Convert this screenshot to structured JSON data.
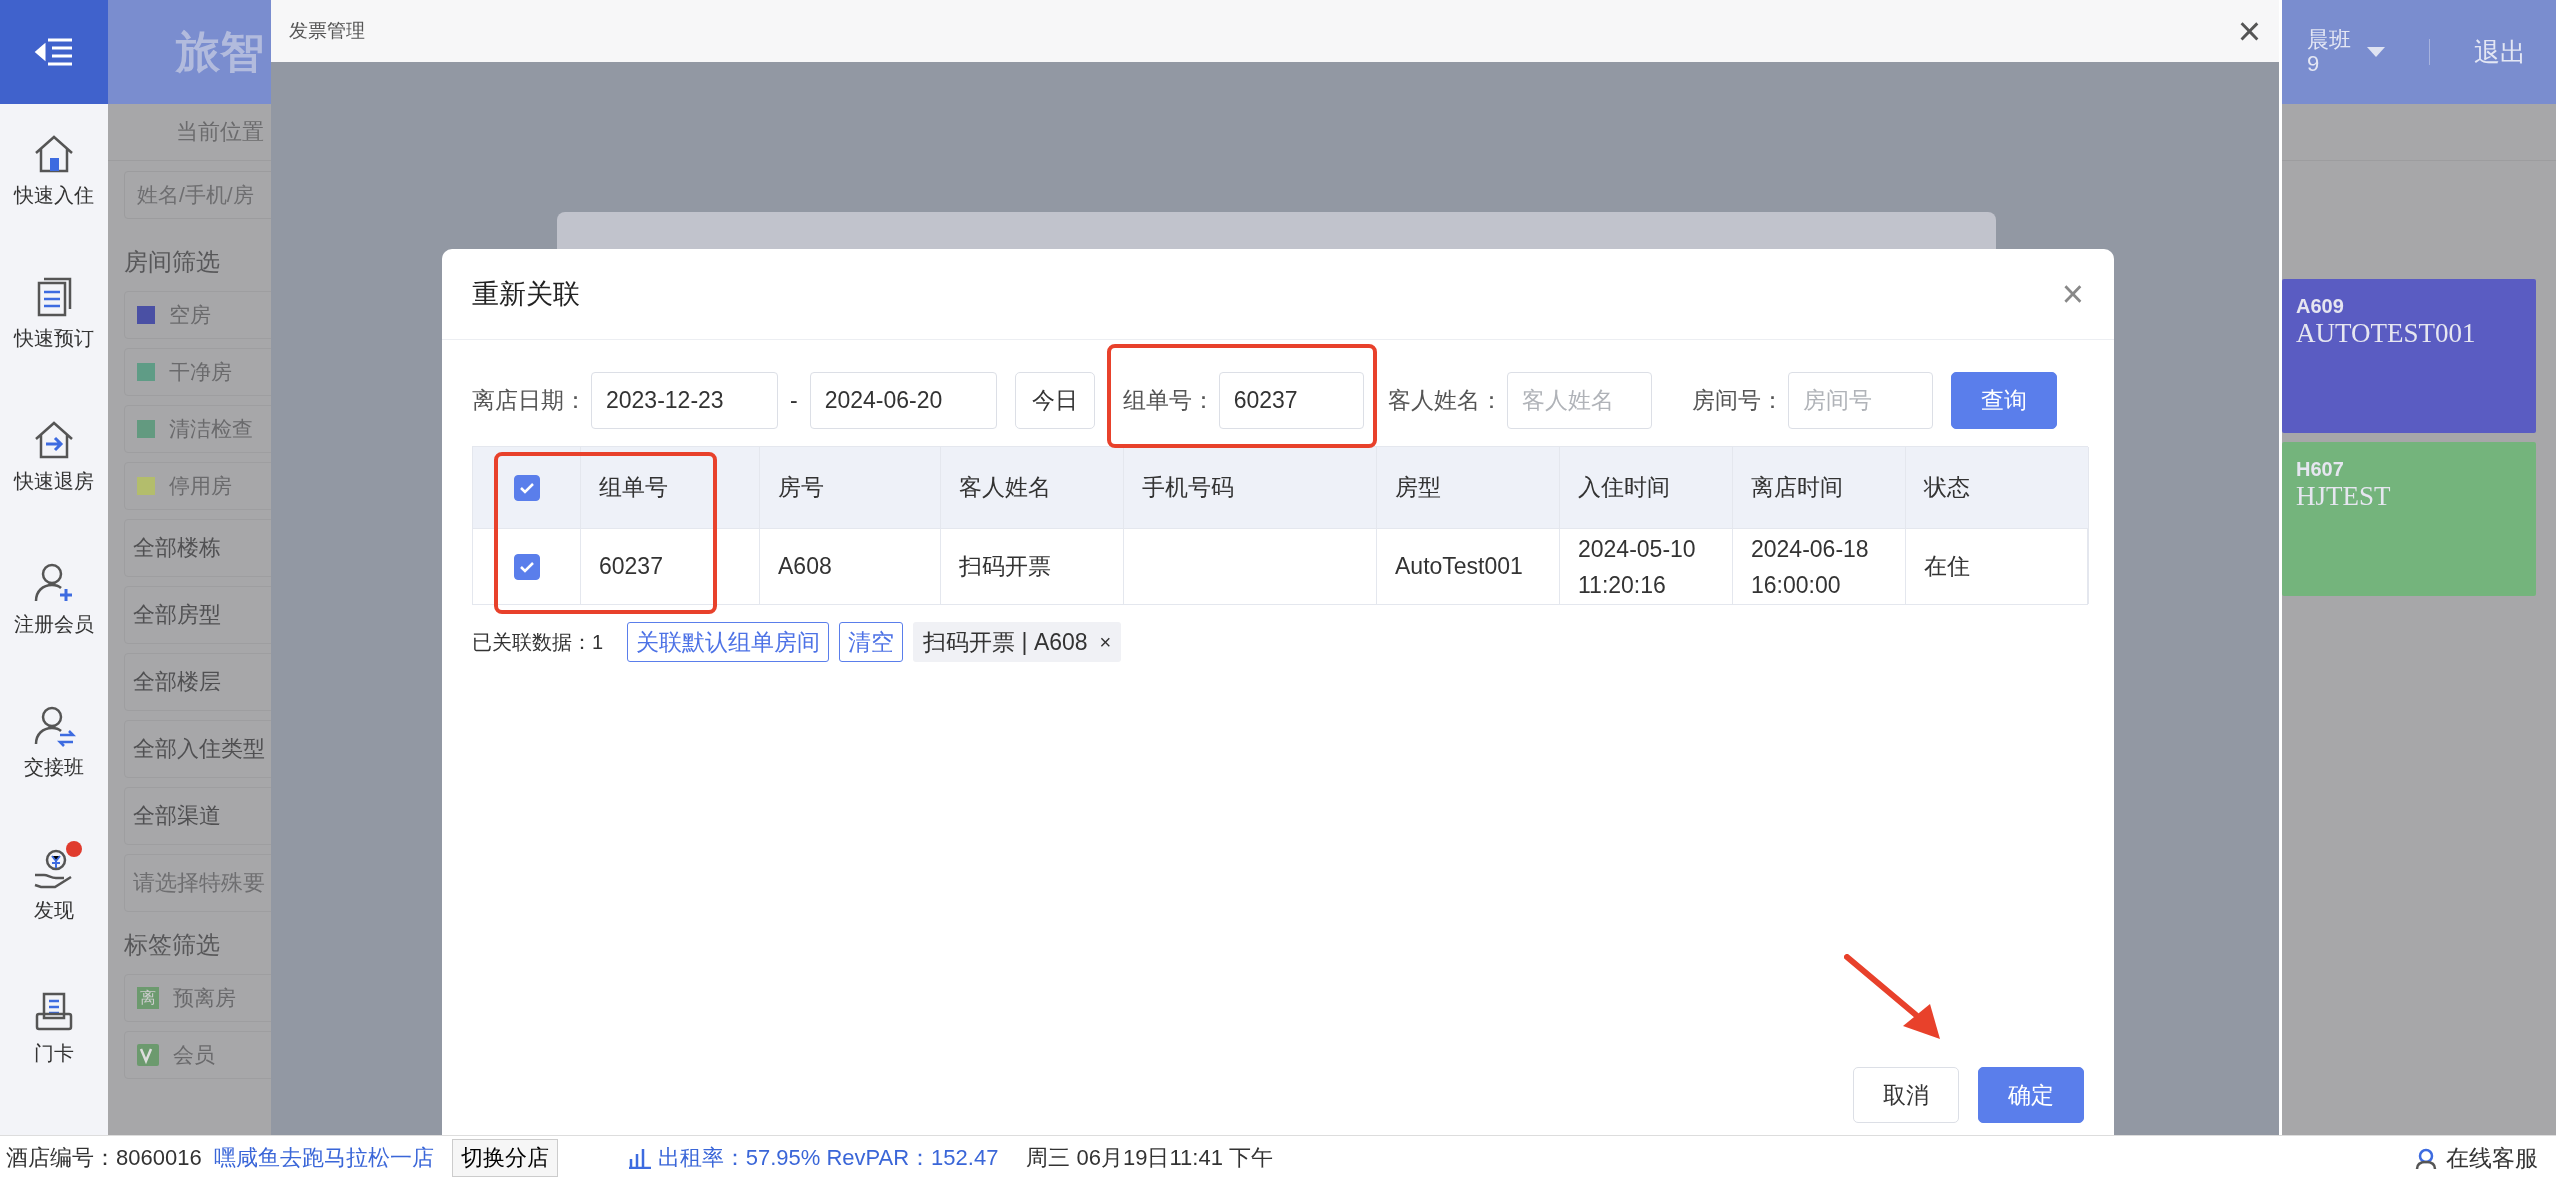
{
  "app": {
    "logo": "旅智",
    "shift": "晨班",
    "shift_sub": "9",
    "logout": "退出",
    "breadcrumb": "当前位置",
    "search_placeholder": "姓名/手机/房",
    "room_filter_title": "房间筛选",
    "room_filters": [
      {
        "label": "空房",
        "color": "#4a50a4"
      },
      {
        "label": "干净房",
        "color": "#5f9c86"
      },
      {
        "label": "清洁检查",
        "color": "#639a80"
      },
      {
        "label": "停用房",
        "color": "#b3bd6c"
      }
    ],
    "dropdowns": [
      "全部楼栋",
      "全部房型",
      "全部楼层",
      "全部入住类型",
      "全部渠道"
    ],
    "special_placeholder": "请选择特殊要",
    "tag_filter_title": "标签筛选",
    "tag_filters": [
      {
        "kind": "char",
        "badge": "离",
        "label": "预离房"
      },
      {
        "kind": "vip",
        "label": "会员"
      }
    ],
    "rooms": [
      {
        "number": "A609",
        "guest": "AUTOTEST001",
        "color": "#5a5cc2"
      },
      {
        "number": "H607",
        "guest": "HJTEST",
        "color": "#74b47c"
      }
    ]
  },
  "rail": [
    {
      "kind": "checkin",
      "label": "快速入住",
      "alert": false
    },
    {
      "kind": "booking",
      "label": "快速预订",
      "alert": false
    },
    {
      "kind": "checkout",
      "label": "快速退房",
      "alert": false
    },
    {
      "kind": "member",
      "label": "注册会员",
      "alert": false
    },
    {
      "kind": "shift",
      "label": "交接班",
      "alert": false
    },
    {
      "kind": "discover",
      "label": "发现",
      "alert": true
    },
    {
      "kind": "card",
      "label": "门卡",
      "alert": false
    }
  ],
  "modal": {
    "title": "发票管理",
    "close": "×"
  },
  "dialog": {
    "title": "重新关联",
    "close": "×",
    "checkout_date": {
      "label": "离店日期：",
      "from": "2023-12-23",
      "separator": "-",
      "to": "2024-06-20",
      "today_button": "今日"
    },
    "fields": [
      {
        "label": "组单号：",
        "value": "60237"
      },
      {
        "label": "客人姓名：",
        "placeholder": "客人姓名"
      },
      {
        "label": "房间号：",
        "placeholder": "房间号"
      }
    ],
    "search_button": "查询",
    "table": {
      "all_checked": true,
      "columns": [
        "组单号",
        "房号",
        "客人姓名",
        "手机号码",
        "房型",
        "入住时间",
        "离店时间",
        "状态"
      ],
      "rows": [
        {
          "checked": true,
          "group_no": "60237",
          "room": "A608",
          "guest": "扫码开票",
          "room_type": "AutoTest001",
          "checkin": [
            "2024-05-10",
            "11:20:16"
          ],
          "checkout": [
            "2024-06-18",
            "16:00:00"
          ],
          "status": "在住"
        }
      ]
    },
    "linked_count": "已关联数据：1",
    "link_default_button": "关联默认组单房间",
    "clear_button": "清空",
    "linked_tags": [
      {
        "text": "扫码开票 | A608",
        "remove": "×"
      }
    ],
    "cancel_button": "取消",
    "confirm_button": "确定"
  },
  "status_bar": {
    "hotel_no": "酒店编号：8060016",
    "hotel_name": "嘿咸鱼去跑马拉松一店",
    "switch_button": "切换分店",
    "occupancy": "出租率：57.95% RevPAR：152.47",
    "datetime": "周三 06月19日11:41 下午",
    "support": "在线客服"
  }
}
